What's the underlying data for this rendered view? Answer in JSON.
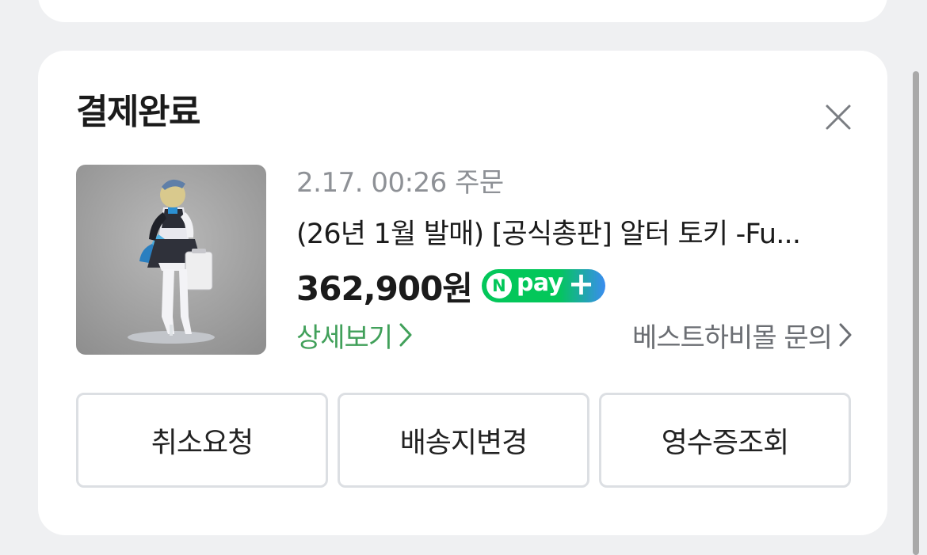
{
  "order_card": {
    "title": "결제완료",
    "order_date": "2.17. 00:26 주문",
    "product_name": "(26년 1월 발매) [공식총판] 알터 토키 -Fu...",
    "price": "362,900원",
    "npay_badge": {
      "n": "N",
      "text": "pay",
      "plus": "+"
    },
    "detail_link": "상세보기",
    "inquiry_link": "베스트하비몰 문의",
    "actions": [
      "취소요청",
      "배송지변경",
      "영수증조회"
    ]
  },
  "colors": {
    "background": "#eff0f2",
    "card": "#ffffff",
    "accent_green": "#41a05a",
    "npay_green": "#03c75a",
    "npay_blue": "#3a8cf0",
    "muted_text": "#8e9196",
    "button_border": "#dcdfe3"
  },
  "icons": {
    "close": "close-icon",
    "detail_chevron": "chevron-right-icon",
    "inquiry_chevron": "chevron-right-icon"
  }
}
